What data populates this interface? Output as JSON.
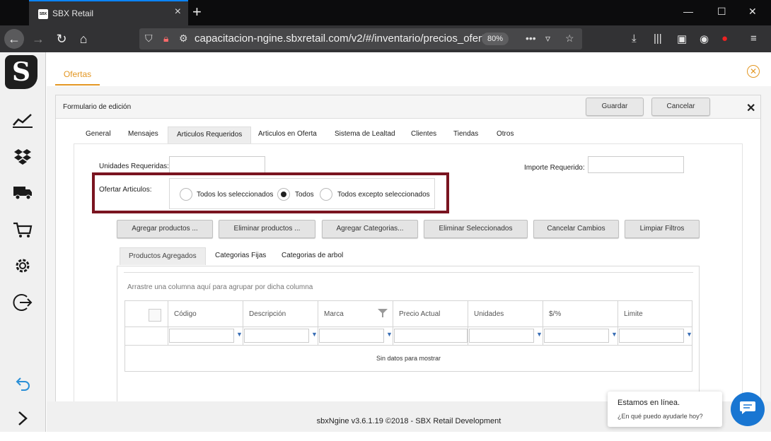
{
  "browser": {
    "tab_title": "SBX Retail",
    "tab_favicon": "SBX",
    "url": "capacitacion-ngine.sbxretail.com/v2/#/inventario/precios_ofertas/",
    "zoom": "80%"
  },
  "header": {
    "section_tab": "Ofertas"
  },
  "panel": {
    "title": "Formulario de edición",
    "save_label": "Guardar",
    "cancel_label": "Cancelar"
  },
  "tabs": [
    {
      "label": "General"
    },
    {
      "label": "Mensajes"
    },
    {
      "label": "Articulos Requeridos",
      "active": true
    },
    {
      "label": "Articulos en Oferta"
    },
    {
      "label": "Sistema de Lealtad"
    },
    {
      "label": "Clientes"
    },
    {
      "label": "Tiendas"
    },
    {
      "label": "Otros"
    }
  ],
  "form": {
    "units_label": "Unidades Requeridas:",
    "units_value": "",
    "amount_label": "Importe Requerido:",
    "amount_value": "",
    "offer_label": "Ofertar Articulos:",
    "radio_options": [
      {
        "label": "Todos los seleccionados",
        "selected": false
      },
      {
        "label": "Todos",
        "selected": true
      },
      {
        "label": "Todos excepto seleccionados",
        "selected": false
      }
    ],
    "highlight_color": "#7a1420"
  },
  "actions": [
    {
      "label": "Agregar productos ..."
    },
    {
      "label": "Eliminar productos ..."
    },
    {
      "label": "Agregar Categorias..."
    },
    {
      "label": "Eliminar Seleccionados"
    },
    {
      "label": "Cancelar Cambios"
    },
    {
      "label": "Limpiar Filtros"
    }
  ],
  "subtabs": [
    {
      "label": "Productos Agregados",
      "active": true
    },
    {
      "label": "Categorias Fijas"
    },
    {
      "label": "Categorias de arbol"
    }
  ],
  "grid": {
    "group_hint": "Arrastre una columna aquí para agrupar por dicha columna",
    "columns": [
      "Código",
      "Descripción",
      "Marca",
      "Precio Actual",
      "Unidades",
      "$/%",
      "Limite"
    ],
    "empty_text": "Sin datos para mostrar"
  },
  "footer": {
    "text": "sbxNgine v3.6.1.19 ©2018 - SBX Retail Development"
  },
  "chat": {
    "status": "Estamos en línea.",
    "prompt": "¿En qué puedo ayudarle hoy?"
  },
  "colors": {
    "accent": "#e39723",
    "browser_tab_accent": "#0a84ff",
    "chat_button": "#1976d2"
  }
}
